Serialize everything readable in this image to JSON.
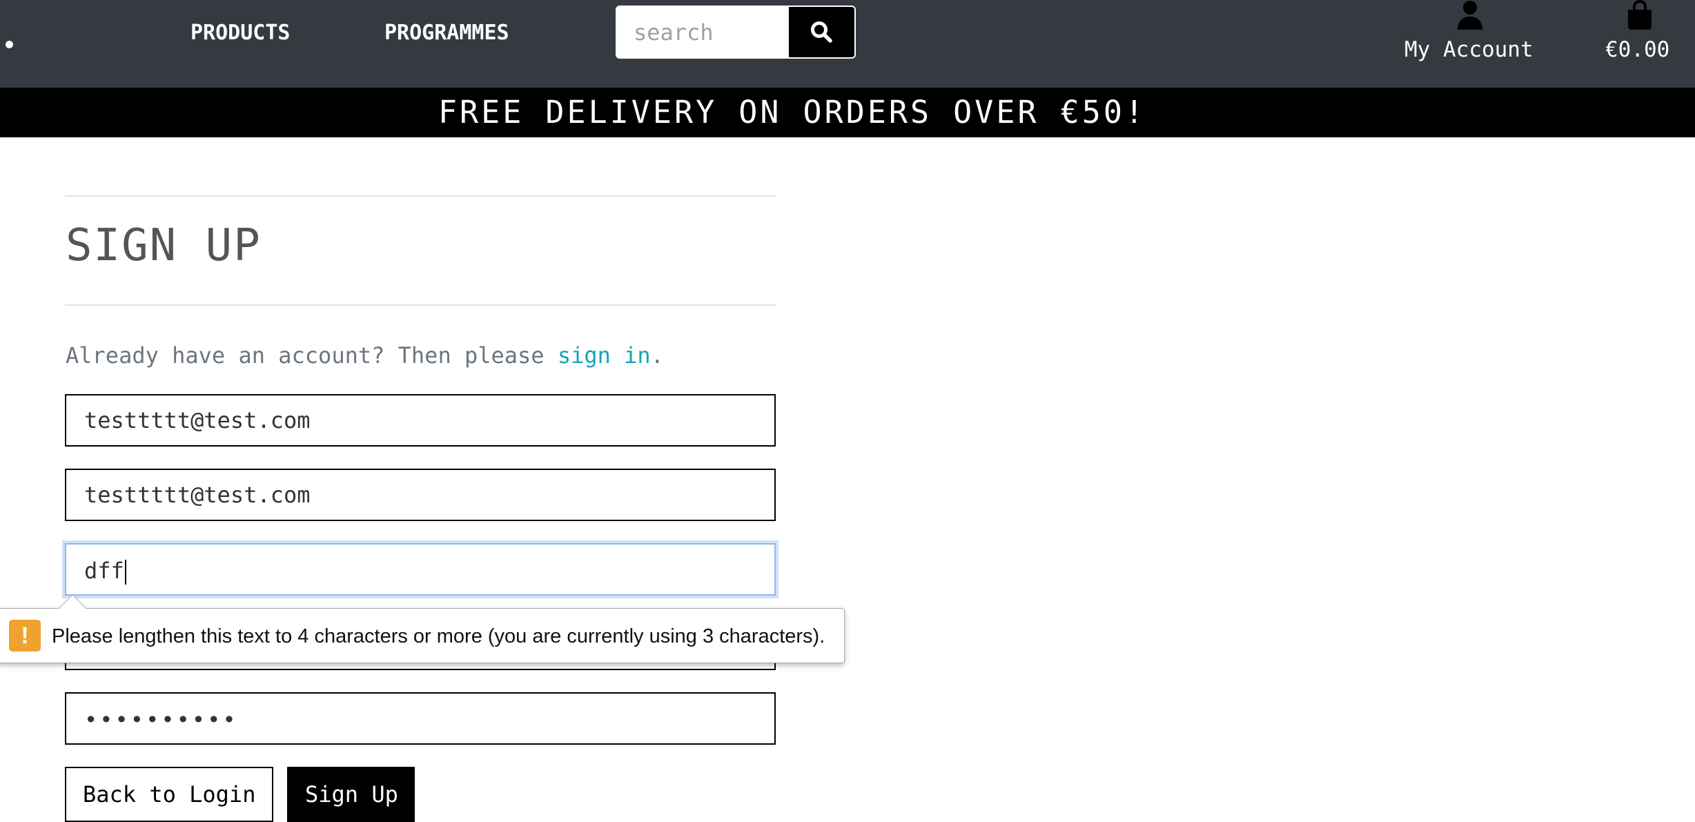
{
  "nav": {
    "products_label": "PRODUCTS",
    "programmes_label": "PROGRAMMES",
    "search_placeholder": "search",
    "account_label": "My Account",
    "cart_total": "€0.00"
  },
  "banner": {
    "text": "FREE DELIVERY ON ORDERS OVER €50!"
  },
  "signup": {
    "title": "SIGN UP",
    "signin_prompt": "Already have an account? Then please ",
    "signin_link": "sign in",
    "signin_suffix": ".",
    "email_value": "testtttt@test.com",
    "email_confirm_value": "testtttt@test.com",
    "username_value": "dff",
    "password_mask": "••••••••••",
    "back_button_label": "Back to Login",
    "submit_button_label": "Sign Up"
  },
  "validation": {
    "message": "Please lengthen this text to 4 characters or more (you are currently using 3 characters).",
    "icon_glyph": "!"
  },
  "colors": {
    "navbar_bg": "#343a40",
    "banner_bg": "#000000",
    "link": "#17a2b8",
    "warning": "#f0a230"
  },
  "icons": {
    "search": "search-icon",
    "account": "user-icon",
    "cart": "shopping-bag-icon",
    "warning": "warning-icon"
  }
}
